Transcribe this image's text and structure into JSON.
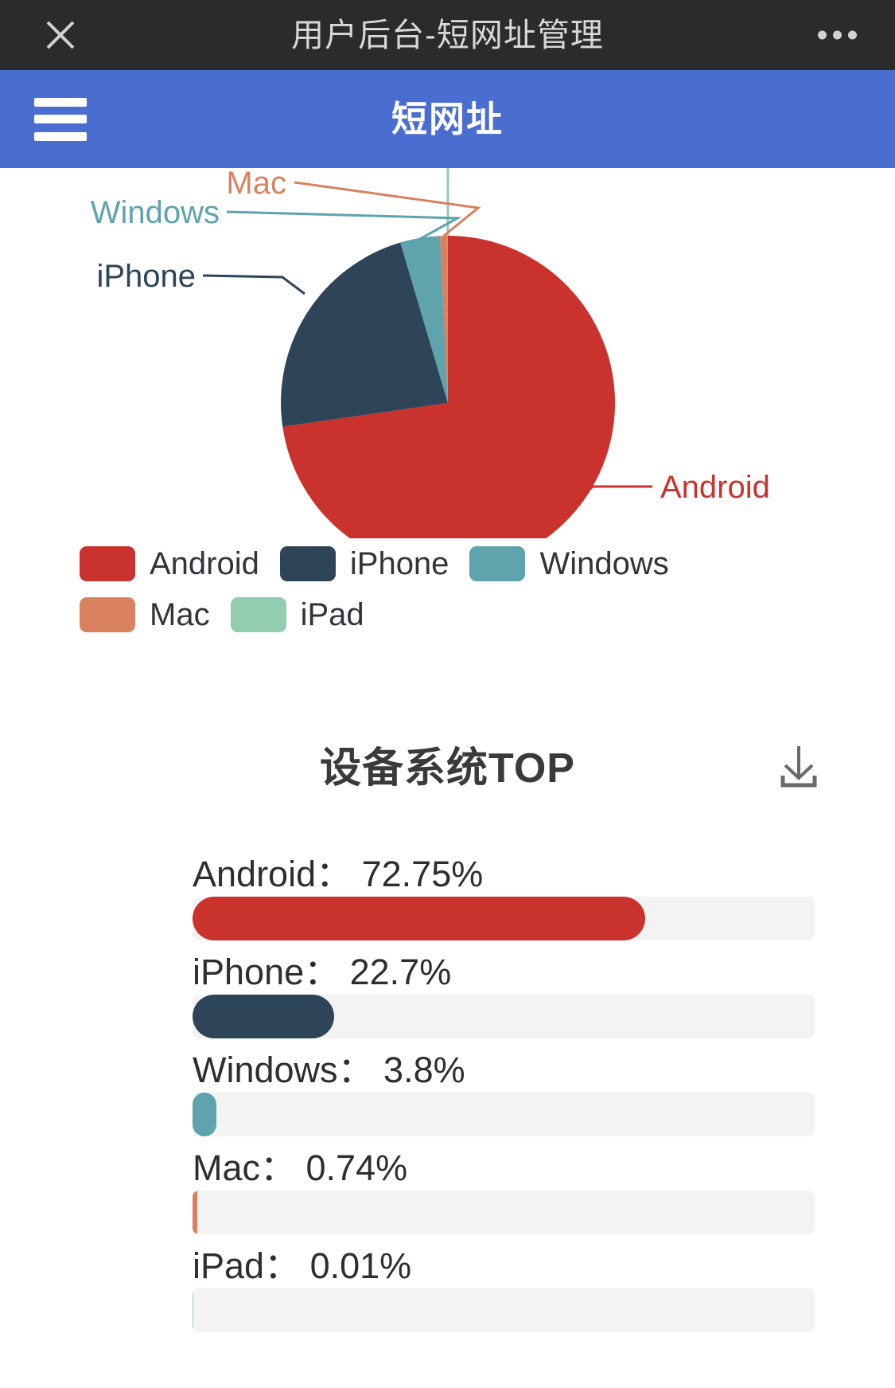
{
  "titlebar": {
    "title": "用户后台-短网址管理",
    "close_icon": "close-icon",
    "more_icon": "more-options-icon"
  },
  "navbar": {
    "title": "短网址",
    "menu_icon": "hamburger-menu-icon",
    "background": "#4a6ed0"
  },
  "section": {
    "title": "设备系统TOP",
    "download_icon": "download-icon"
  },
  "legend": {
    "items": [
      {
        "label": "Android",
        "color": "#c9322d"
      },
      {
        "label": "iPhone",
        "color": "#2d4557"
      },
      {
        "label": "Windows",
        "color": "#5fa3ac"
      },
      {
        "label": "Mac",
        "color": "#d9815f"
      },
      {
        "label": "iPad",
        "color": "#92cdaf"
      }
    ]
  },
  "bars": {
    "rows": [
      {
        "label": "Android： 72.75%",
        "name": "Android",
        "value": 72.75,
        "color": "#c9322d"
      },
      {
        "label": "iPhone： 22.7%",
        "name": "iPhone",
        "value": 22.7,
        "color": "#2d4557"
      },
      {
        "label": "Windows： 3.8%",
        "name": "Windows",
        "value": 3.8,
        "color": "#5fa3ac"
      },
      {
        "label": "Mac： 0.74%",
        "name": "Mac",
        "value": 0.74,
        "color": "#d9815f"
      },
      {
        "label": "iPad： 0.01%",
        "name": "iPad",
        "value": 0.01,
        "color": "#92cdaf"
      }
    ],
    "track_color": "#f3f3f3"
  },
  "chart_data": {
    "type": "pie",
    "title": "设备系统TOP",
    "labels": [
      "Android",
      "iPhone",
      "Windows",
      "Mac",
      "iPad"
    ],
    "values": [
      72.75,
      22.7,
      3.8,
      0.74,
      0.01
    ],
    "unit": "%",
    "colors": [
      "#c9322d",
      "#2d4557",
      "#5fa3ac",
      "#d9815f",
      "#92cdaf"
    ],
    "legend_position": "bottom",
    "annotations": [
      {
        "text": "Android",
        "color": "#c9322d"
      },
      {
        "text": "iPhone",
        "color": "#2d4557"
      },
      {
        "text": "Windows",
        "color": "#5fa3ac"
      },
      {
        "text": "Mac",
        "color": "#d9815f"
      }
    ]
  }
}
